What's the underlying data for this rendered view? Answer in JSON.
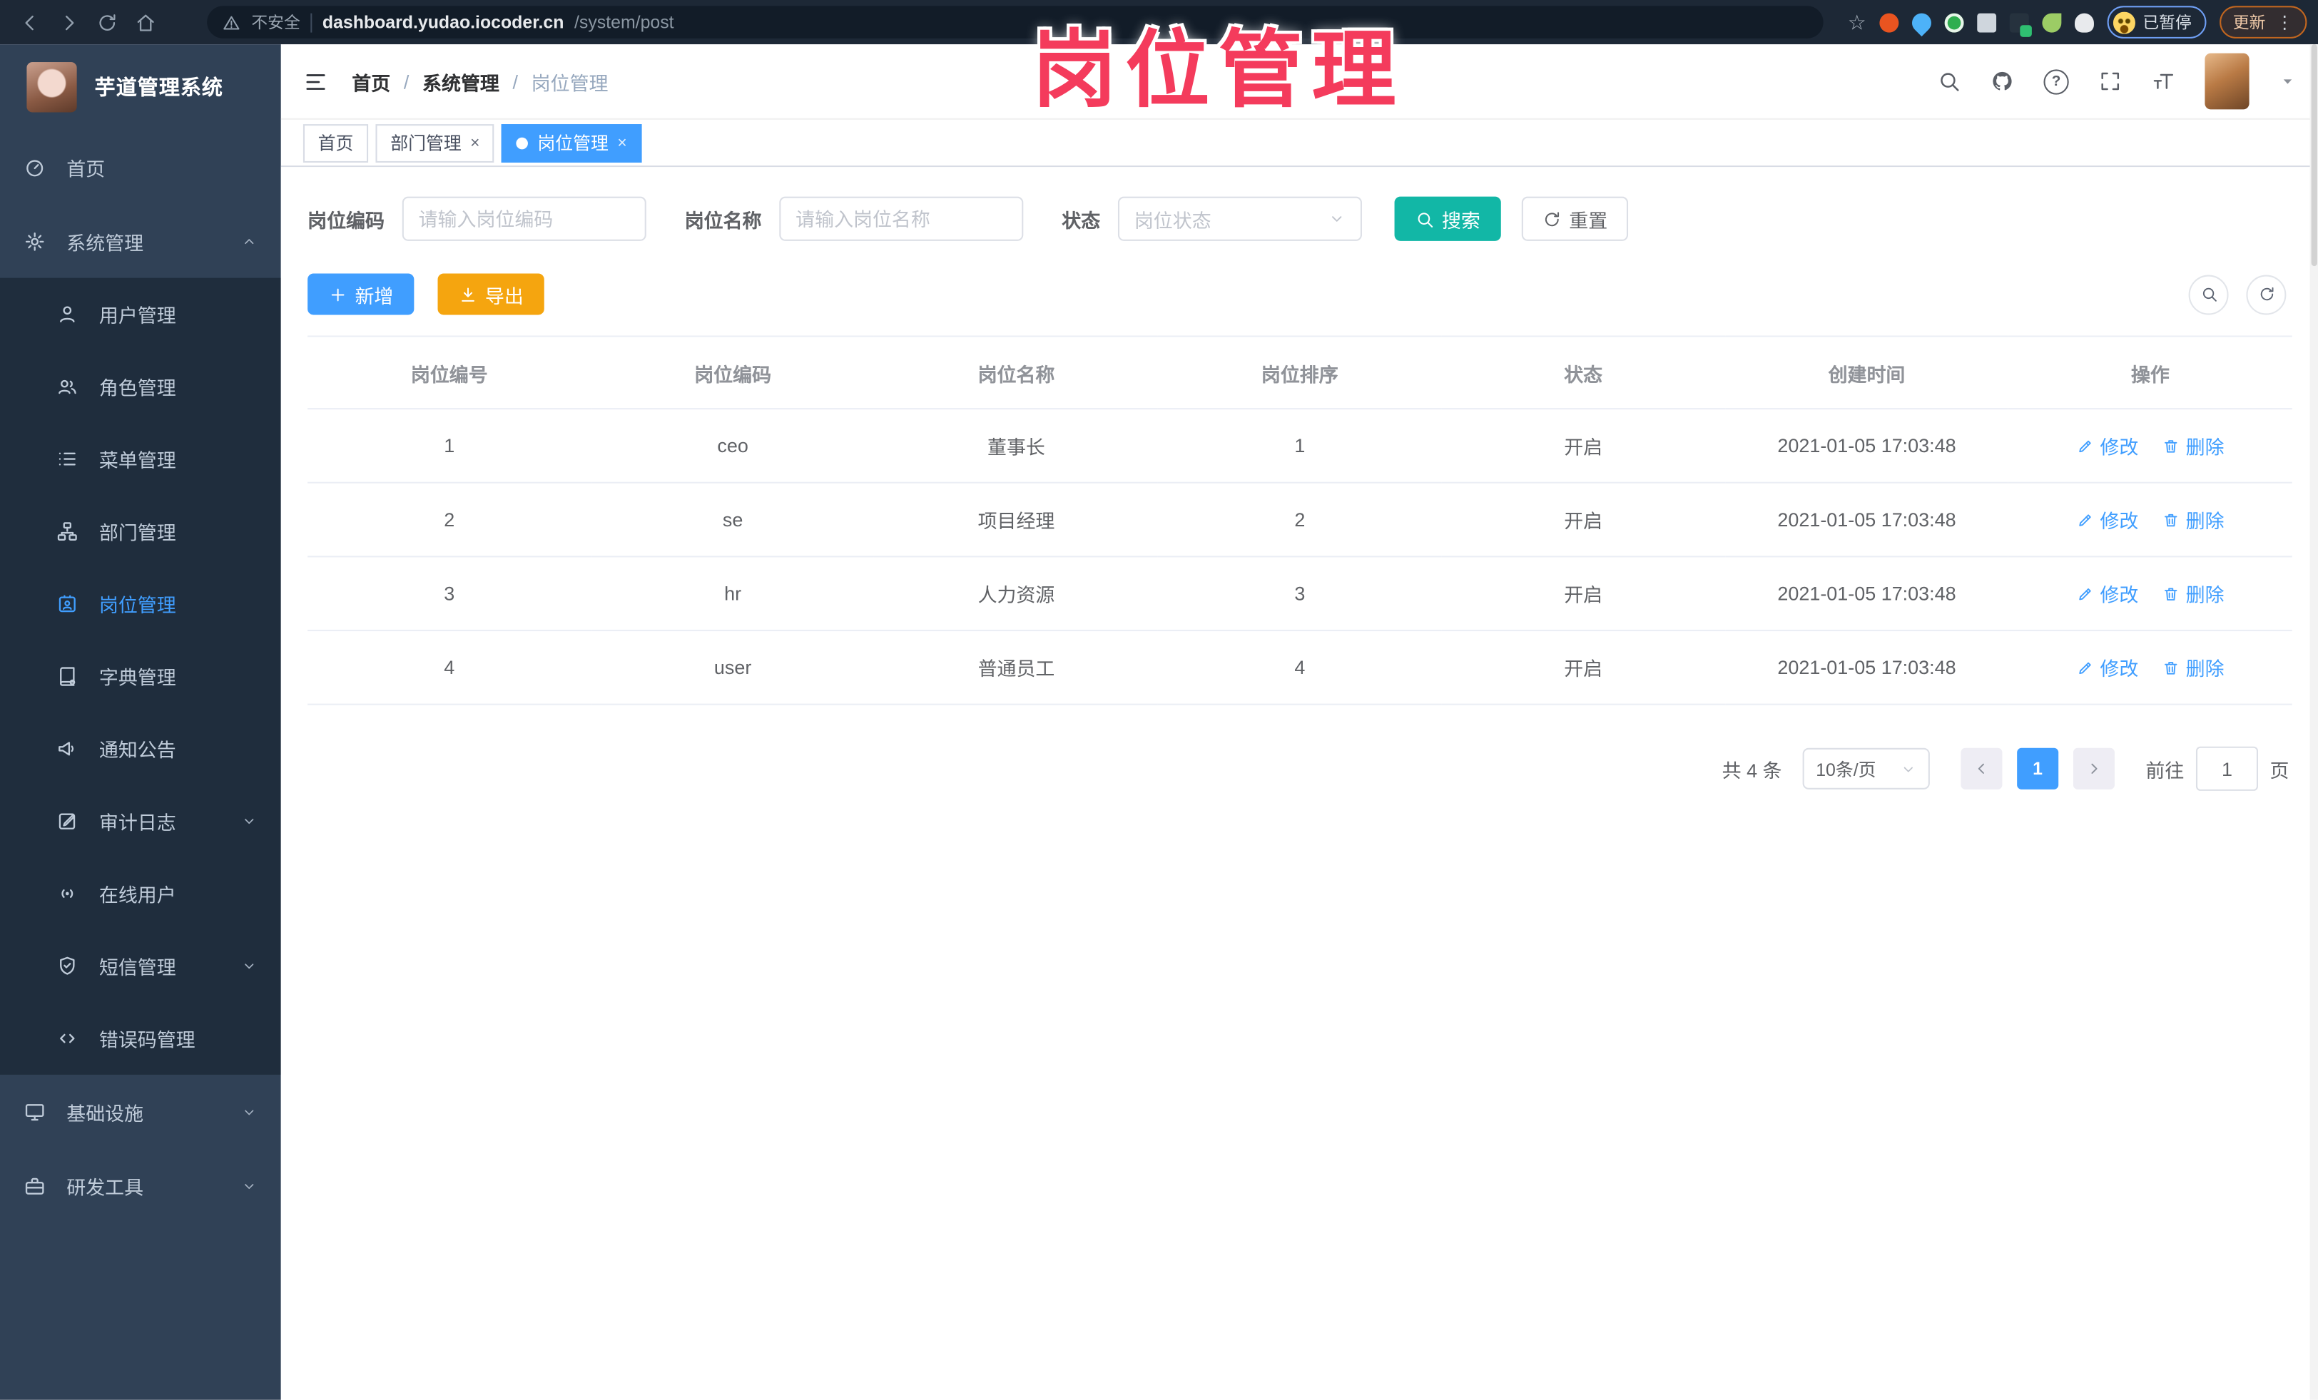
{
  "browser": {
    "security_label": "不安全",
    "url_host": "dashboard.yudao.iocoder.cn",
    "url_path": "/system/post",
    "paused_label": "已暂停",
    "update_label": "更新"
  },
  "annotation": {
    "title": "岗位管理"
  },
  "sidebar": {
    "app_title": "芋道管理系统",
    "items": [
      {
        "key": "home",
        "label": "首页",
        "icon": "dashboard",
        "level": 1
      },
      {
        "key": "system-management",
        "label": "系统管理",
        "icon": "gear",
        "level": 1,
        "arrow": "up"
      },
      {
        "key": "user-management",
        "label": "用户管理",
        "icon": "user",
        "level": 2
      },
      {
        "key": "role-management",
        "label": "角色管理",
        "icon": "users",
        "level": 2
      },
      {
        "key": "menu-management",
        "label": "菜单管理",
        "icon": "menu-list",
        "level": 2
      },
      {
        "key": "dept-management",
        "label": "部门管理",
        "icon": "org-tree",
        "level": 2
      },
      {
        "key": "post-management",
        "label": "岗位管理",
        "icon": "badge",
        "level": 2,
        "active": true
      },
      {
        "key": "dict-management",
        "label": "字典管理",
        "icon": "dict",
        "level": 2
      },
      {
        "key": "notice-announcement",
        "label": "通知公告",
        "icon": "announce",
        "level": 2
      },
      {
        "key": "audit-log",
        "label": "审计日志",
        "icon": "audit",
        "level": 2,
        "arrow": "down"
      },
      {
        "key": "online-users",
        "label": "在线用户",
        "icon": "online",
        "level": 2
      },
      {
        "key": "sms-management",
        "label": "短信管理",
        "icon": "shield",
        "level": 2,
        "arrow": "down"
      },
      {
        "key": "error-code-management",
        "label": "错误码管理",
        "icon": "code",
        "level": 2
      },
      {
        "key": "infrastructure",
        "label": "基础设施",
        "icon": "monitor",
        "level": 1,
        "arrow": "down"
      },
      {
        "key": "dev-tools",
        "label": "研发工具",
        "icon": "toolbox",
        "level": 1,
        "arrow": "down"
      }
    ]
  },
  "navbar": {
    "breadcrumbs": [
      "首页",
      "系统管理",
      "岗位管理"
    ],
    "separator": "/"
  },
  "tabs": [
    {
      "label": "首页",
      "closable": false,
      "active": false
    },
    {
      "label": "部门管理",
      "closable": true,
      "active": false
    },
    {
      "label": "岗位管理",
      "closable": true,
      "active": true
    }
  ],
  "ui": {
    "close_glyph": "×",
    "help_glyph": "?",
    "dots_glyph": "⋮",
    "star_glyph": "☆"
  },
  "filters": {
    "post_code": {
      "label": "岗位编码",
      "placeholder": "请输入岗位编码",
      "value": ""
    },
    "post_name": {
      "label": "岗位名称",
      "placeholder": "请输入岗位名称",
      "value": ""
    },
    "status": {
      "label": "状态",
      "placeholder": "岗位状态"
    },
    "search_label": "搜索",
    "reset_label": "重置"
  },
  "toolbar": {
    "add_label": "新增",
    "export_label": "导出"
  },
  "table": {
    "columns": [
      "岗位编号",
      "岗位编码",
      "岗位名称",
      "岗位排序",
      "状态",
      "创建时间",
      "操作"
    ],
    "rows": [
      {
        "id": "1",
        "code": "ceo",
        "name": "董事长",
        "sort": "1",
        "status": "开启",
        "created": "2021-01-05 17:03:48"
      },
      {
        "id": "2",
        "code": "se",
        "name": "项目经理",
        "sort": "2",
        "status": "开启",
        "created": "2021-01-05 17:03:48"
      },
      {
        "id": "3",
        "code": "hr",
        "name": "人力资源",
        "sort": "3",
        "status": "开启",
        "created": "2021-01-05 17:03:48"
      },
      {
        "id": "4",
        "code": "user",
        "name": "普通员工",
        "sort": "4",
        "status": "开启",
        "created": "2021-01-05 17:03:48"
      }
    ],
    "actions": {
      "edit": "修改",
      "delete": "删除"
    }
  },
  "pagination": {
    "total_text": "共 4 条",
    "page_size": "10条/页",
    "current_page": "1",
    "goto_label": "前往",
    "goto_value": "1",
    "page_unit": "页"
  },
  "colors": {
    "accent_blue": "#409eff",
    "search_teal": "#12b7a6",
    "export_orange": "#f5a50f",
    "sidebar_bg": "#304156",
    "submenu_bg": "#1f2d3d",
    "annotation_pink": "#f43b5c"
  }
}
